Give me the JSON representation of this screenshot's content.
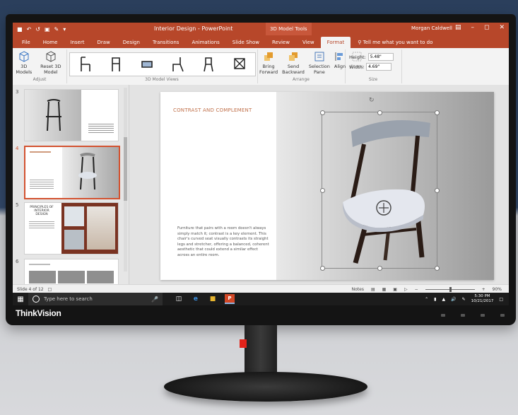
{
  "window": {
    "title": "Interior Design - PowerPoint",
    "context_tab": "3D Model Tools",
    "user": "Morgan Caldwell"
  },
  "tabs": [
    {
      "label": "File"
    },
    {
      "label": "Home"
    },
    {
      "label": "Insert"
    },
    {
      "label": "Draw"
    },
    {
      "label": "Design"
    },
    {
      "label": "Transitions"
    },
    {
      "label": "Animations"
    },
    {
      "label": "Slide Show"
    },
    {
      "label": "Review"
    },
    {
      "label": "View"
    },
    {
      "label": "Format"
    }
  ],
  "tell_me": "Tell me what you want to do",
  "ribbon": {
    "adjust": {
      "models_label": "3D Models",
      "reset_label": "Reset 3D Model",
      "group_label": "Adjust"
    },
    "styles_group_label": "3D Model Views",
    "arrange": {
      "bring_forward": "Bring Forward",
      "send_backward": "Send Backward",
      "selection_pane": "Selection Pane",
      "align": "Align",
      "group": "Group",
      "group_label": "Arrange"
    },
    "size": {
      "height_label": "Height:",
      "height_value": "5.48\"",
      "width_label": "Width:",
      "width_value": "4.69\"",
      "group_label": "Size"
    }
  },
  "thumbnails": [
    {
      "number": "3"
    },
    {
      "number": "4"
    },
    {
      "number": "5",
      "heading": "PRINCIPLES OF INTERIOR DESIGN"
    },
    {
      "number": "6"
    }
  ],
  "slide": {
    "title": "CONTRAST AND COMPLEMENT",
    "body": "Furniture that pairs with a room doesn't always simply match it; contrast is a key element. This chair's curved seat visually contrasts its straight legs and stretcher, offering a balanced, coherent aesthetic that could extend a similar effect across an entire room."
  },
  "status": {
    "slide_counter": "Slide 4 of 12",
    "notes": "Notes",
    "zoom": "90%"
  },
  "taskbar": {
    "search_placeholder": "Type here to search",
    "time": "5:30 PM",
    "date": "10/21/2017"
  },
  "bezel": {
    "brand": "ThinkVision"
  },
  "colors": {
    "accent": "#b7472a",
    "selection": "#d35230",
    "taskbar": "#1c1c1c"
  }
}
